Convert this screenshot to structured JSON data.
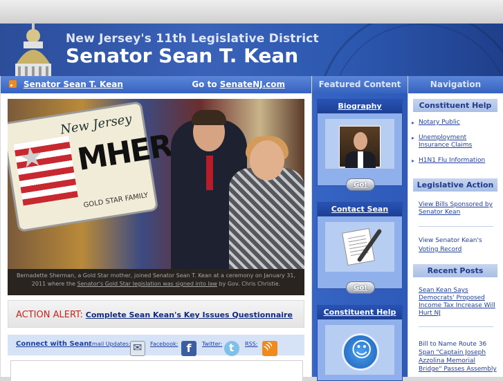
{
  "header": {
    "district": "New Jersey's 11th Legislative District",
    "senator": "Senator Sean T. Kean"
  },
  "main_bar": {
    "title_link": "Senator Sean T. Kean",
    "goto_prefix": "Go to",
    "goto_link": "SenateNJ.com"
  },
  "photo": {
    "plate_state": "New Jersey",
    "plate_text": "MHERO",
    "plate_footer": "GOLD STAR FAMILY",
    "caption_part1": "Bernadette Sherman, a Gold Star mother, joined Senator Sean T. Kean at a ceremony on January 31, 2011 where the",
    "caption_link": "Senator's Gold Star legislation was signed into law",
    "caption_part2": "by Gov. Chris Christie."
  },
  "alert": {
    "label": "ACTION ALERT:",
    "link": "Complete Sean Kean's Key Issues Questionnaire"
  },
  "connect": {
    "title": "Connect with Sean:",
    "email": "Email Updates:",
    "facebook": "Facebook:",
    "twitter": "Twitter:",
    "rss": "RSS:"
  },
  "featured": {
    "header": "Featured Content",
    "boxes": [
      {
        "title": "Biography",
        "go": "Go!"
      },
      {
        "title": "Contact Sean",
        "go": "Go!"
      },
      {
        "title": "Constituent Help"
      }
    ]
  },
  "navigation": {
    "header": "Navigation",
    "constituent_help": "Constituent Help",
    "help_links": [
      "Notary Public",
      "Unemployment Insurance Claims",
      "H1N1 Flu Information"
    ],
    "legislative_action": "Legislative Action",
    "view_bills": "View Bills Sponsored by Senator Kean",
    "voting_prefix": "View Senator Kean's",
    "voting_link": "Voting Record",
    "recent_posts": "Recent Posts",
    "post1": "Sean Kean Says Democrats' Proposed Income Tax Increase Will Hurt NJ",
    "post2_prefix": "Bill to Name Route 36",
    "post2_link": "Span \"Captain Joseph Azzolina Memorial Bridge\" Passes Assembly"
  }
}
